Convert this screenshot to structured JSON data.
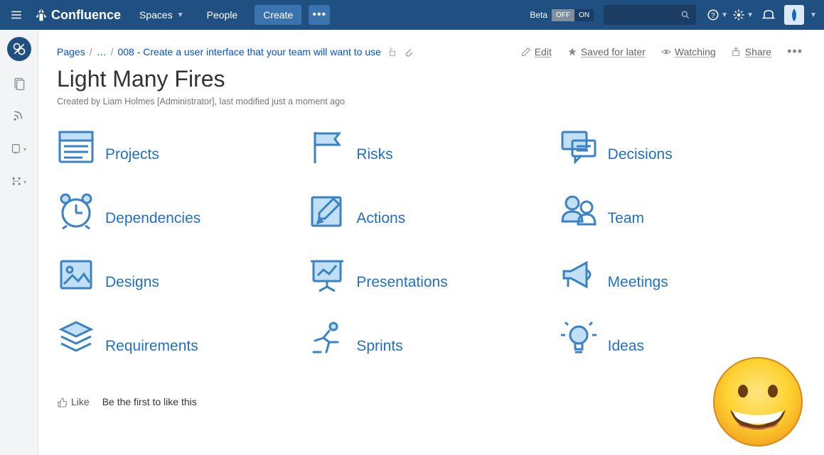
{
  "header": {
    "brand": "Confluence",
    "nav_spaces": "Spaces",
    "nav_people": "People",
    "nav_create": "Create",
    "more_dots": "•••",
    "beta_label": "Beta",
    "toggle_off": "OFF",
    "toggle_on": "ON"
  },
  "breadcrumb": {
    "root": "Pages",
    "ellipsis": "…",
    "leaf": "008 - Create a user interface that your team will want to use"
  },
  "actions": {
    "edit": "Edit",
    "saved": "Saved for later",
    "watching": "Watching",
    "share": "Share",
    "dots": "•••"
  },
  "page": {
    "title": "Light Many Fires",
    "meta": "Created by Liam Holmes [Administrator], last modified just a moment ago"
  },
  "tiles": [
    {
      "label": "Projects"
    },
    {
      "label": "Risks"
    },
    {
      "label": "Decisions"
    },
    {
      "label": "Dependencies"
    },
    {
      "label": "Actions"
    },
    {
      "label": "Team"
    },
    {
      "label": "Designs"
    },
    {
      "label": "Presentations"
    },
    {
      "label": "Meetings"
    },
    {
      "label": "Requirements"
    },
    {
      "label": "Sprints"
    },
    {
      "label": "Ideas"
    }
  ],
  "like": {
    "label": "Like",
    "status": "Be the first to like this"
  }
}
